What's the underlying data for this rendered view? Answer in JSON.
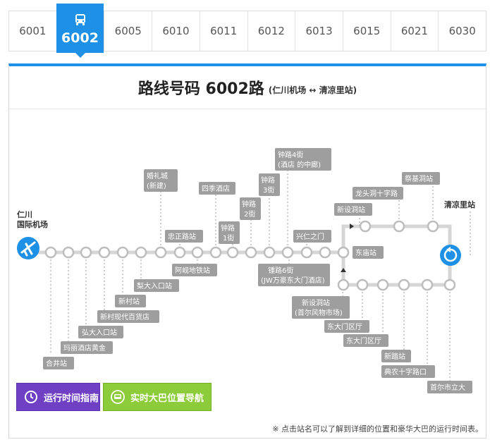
{
  "tabs": [
    {
      "label": "6001",
      "active": false
    },
    {
      "label": "6002",
      "active": true
    },
    {
      "label": "6005",
      "active": false
    },
    {
      "label": "6010",
      "active": false
    },
    {
      "label": "6011",
      "active": false
    },
    {
      "label": "6012",
      "active": false
    },
    {
      "label": "6013",
      "active": false
    },
    {
      "label": "6015",
      "active": false
    },
    {
      "label": "6021",
      "active": false
    },
    {
      "label": "6030",
      "active": false
    }
  ],
  "header": {
    "title": "路线号码 6002路",
    "subtitle": "(仁川机场 ↔ 清凉里站)"
  },
  "route": {
    "start_terminal": [
      "仁川",
      "国际机场"
    ],
    "end_terminal": "清凉里站",
    "stations": {
      "s1": "合井站",
      "s2": "玛丽酒店黄金",
      "s3": "弘大入口站",
      "s4": "新村现代百货店",
      "s5": "新村站",
      "s6": "梨大入口站",
      "s7": [
        "婚礼城",
        "(新建)"
      ],
      "s8": "忠正路站",
      "s9": "阿岘地铁站",
      "s10": "四季酒店",
      "s11": [
        "钟路",
        "1街"
      ],
      "s12": [
        "钟路",
        "2街"
      ],
      "s13": [
        "钟路",
        "3街"
      ],
      "s14": [
        "钟路4街",
        "(酒店 的中廊)"
      ],
      "s15": [
        "锺路6街",
        "(JW万豪东大门酒店)"
      ],
      "s16": "兴仁之门",
      "s17": "东庙站",
      "s18": "新设洞站",
      "s19": "龙头洞十字路",
      "s20": "祭基洞站",
      "s21": [
        "新设洞站",
        "(首尔风物市场)"
      ],
      "s22": "东大门区厅",
      "s23": "东大门区厅",
      "s24": "新踏站",
      "s25": "典农十字路口",
      "s26": "首尔市立大"
    }
  },
  "buttons": {
    "timetable": "运行时间指南",
    "realtime": "实时大巴位置导航"
  },
  "icons": {
    "bus": "bus-icon",
    "airplane": "airplane-icon",
    "loop": "loop-arrow-icon",
    "clock": "clock-icon",
    "bus_badge": "bus-badge-icon"
  },
  "colors": {
    "accent": "#1e90e6",
    "timetable_button": "#6f3fc4",
    "realtime_button": "#8ccb3a",
    "station_label": "#9e9e9e"
  },
  "footnote": "※ 点击站名可以了解到详细的位置和豪华大巴的运行时间表。"
}
